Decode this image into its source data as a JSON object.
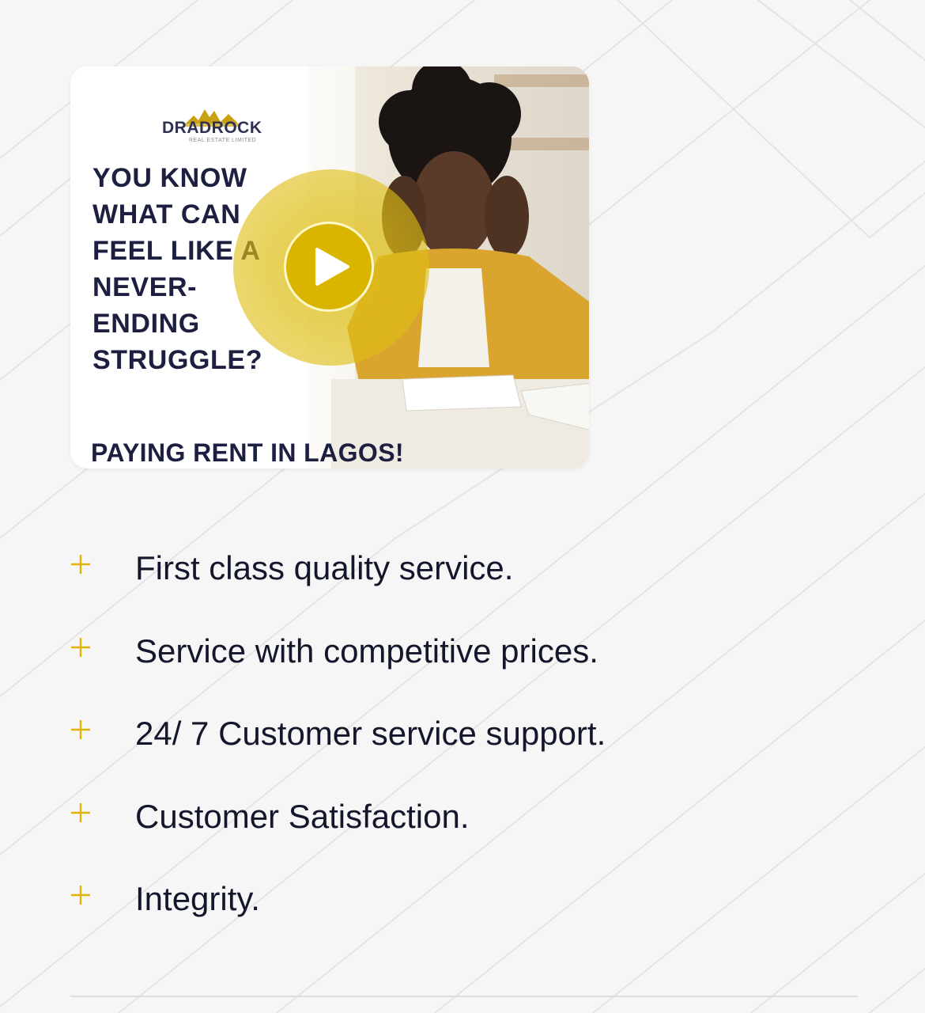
{
  "video": {
    "logo_text": "DRADROCK",
    "logo_tagline": "REAL ESTATE LIMITED",
    "headline": "YOU KNOW\nWHAT CAN\nFEEL LIKE A\nNEVER-ENDING\nSTRUGGLE?",
    "footer": "PAYING RENT IN LAGOS!",
    "play_icon": "play-icon",
    "accent_color": "#d9b500"
  },
  "features": {
    "icon": "plus-icon",
    "icon_color": "#e0b400",
    "items": [
      {
        "label": "First class quality service."
      },
      {
        "label": "Service with competitive prices."
      },
      {
        "label": "24/ 7 Customer service support."
      },
      {
        "label": "Customer Satisfaction."
      },
      {
        "label": "Integrity."
      }
    ]
  }
}
